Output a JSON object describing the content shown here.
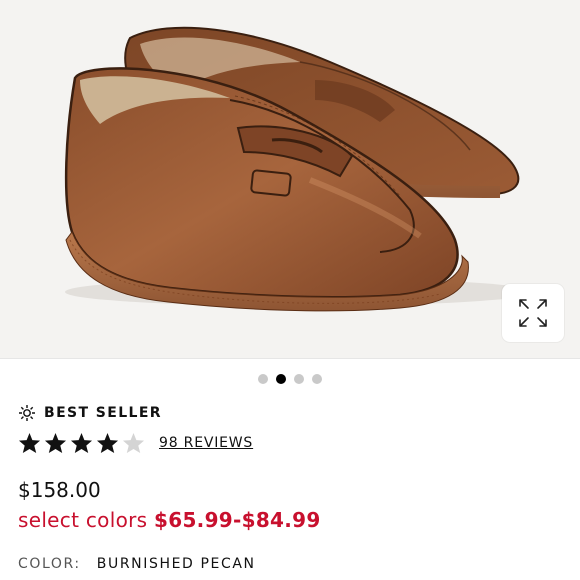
{
  "gallery": {
    "image_alt": "Brown leather penny loafers",
    "expand_icon": "expand-arrows-icon",
    "slide_count": 4,
    "active_slide": 2
  },
  "badge": {
    "icon": "sparkle-badge-icon",
    "label": "BEST SELLER"
  },
  "rating": {
    "value": 4,
    "max": 5,
    "reviews_label": "98 REVIEWS"
  },
  "pricing": {
    "price": "$158.00",
    "sale_prefix": "select colors",
    "sale_range": "$65.99-$84.99"
  },
  "color": {
    "label": "COLOR:",
    "value": "BURNISHED PECAN"
  },
  "colors": {
    "sale": "#c8102e",
    "text": "#111111",
    "dot_inactive": "#c9c9c9",
    "leather": "#9a5a36"
  }
}
